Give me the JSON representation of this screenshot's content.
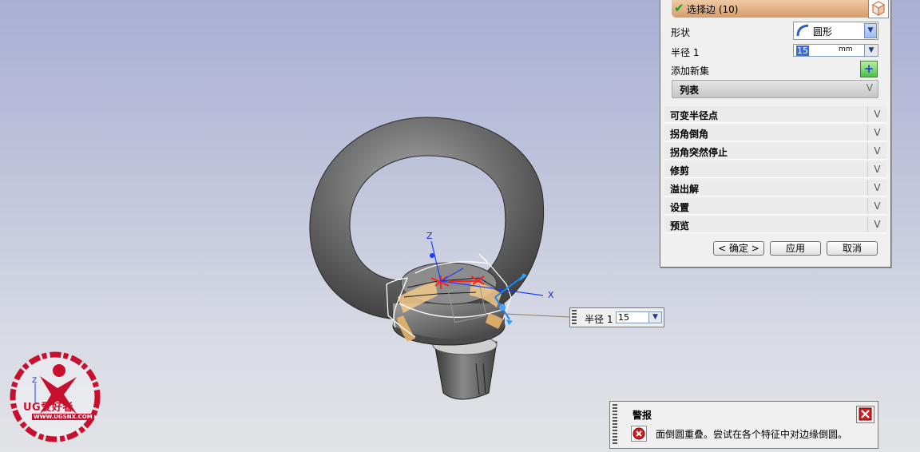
{
  "dialog": {
    "select_edge_label": "选择边 (10)",
    "shape_label": "形状",
    "shape_value": "圆形",
    "radius_label": "半径 1",
    "radius_value": "15",
    "radius_unit": "mm",
    "add_set_label": "添加新集",
    "list_label": "列表",
    "sections": [
      {
        "label": "可变半径点"
      },
      {
        "label": "拐角倒角"
      },
      {
        "label": "拐角突然停止"
      },
      {
        "label": "修剪"
      },
      {
        "label": "溢出解"
      },
      {
        "label": "设置"
      },
      {
        "label": "预览"
      }
    ],
    "ok_label": "< 确定 >",
    "apply_label": "应用",
    "cancel_label": "取消"
  },
  "viewport": {
    "axis_z": "Z",
    "axis_x": "X",
    "corner_axis_z": "Z"
  },
  "onscreen_input": {
    "label": "半径 1",
    "value": "15"
  },
  "alert": {
    "title": "警报",
    "message": "面倒圆重叠。尝试在各个特征中对边缘倒圆。"
  },
  "watermark": {
    "brand": "UG爱好者",
    "url": "WWW.UGSNX.COM"
  },
  "icons": {
    "check": "check-icon",
    "cube": "cube-icon",
    "shape": "arc-shape-icon",
    "add": "add-set-icon",
    "error": "error-icon",
    "close": "close-icon"
  }
}
